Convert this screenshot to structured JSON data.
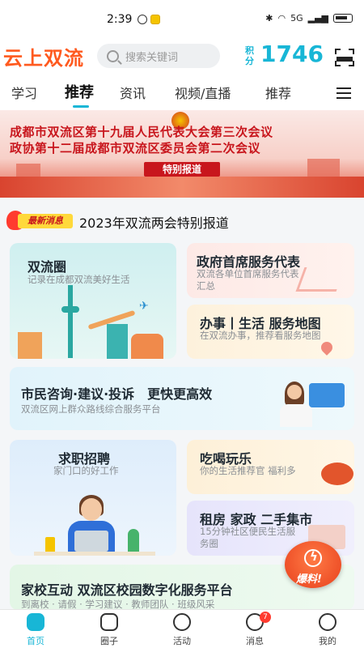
{
  "status_bar": {
    "time": "2:39",
    "signal_text": "5G"
  },
  "header": {
    "logo": "云上双流",
    "search_placeholder": "搜索关键词",
    "points_label": "积分",
    "points_value": "1746"
  },
  "tabs": [
    {
      "label": "学习"
    },
    {
      "label": "推荐",
      "active": true
    },
    {
      "label": "资讯"
    },
    {
      "label": "视频/直播"
    },
    {
      "label": "推荐"
    }
  ],
  "banner": {
    "line1": "成都市双流区第十九届人民代表大会第三次会议",
    "line2": "政协第十二届成都市双流区委员会第二次会议",
    "tag": "特别报道"
  },
  "news": {
    "badge": "最新消息",
    "title": "2023年双流两会特别报道"
  },
  "cards": {
    "circle": {
      "title": "双流圈",
      "sub": "记录在成都双流美好生活"
    },
    "rep": {
      "title": "政府首席服务代表",
      "sub": "双流各单位首席服务代表汇总"
    },
    "map": {
      "title": "办事丨生活 服务地图",
      "sub": "在双流办事，推荐看服务地图"
    },
    "consult": {
      "title": "市民咨询·建议·投诉　更快更高效",
      "sub": "双流区网上群众路线综合服务平台"
    },
    "job": {
      "title": "求职招聘",
      "sub": "家门口的好工作"
    },
    "food": {
      "title": "吃喝玩乐",
      "sub": "你的生活推荐官 福利多"
    },
    "rent": {
      "title": "租房 家政 二手集市",
      "sub": "15分钟社区便民生活服务圈"
    },
    "school": {
      "title": "家校互动 双流区校园数字化服务平台",
      "sub": "到离校 · 请假 · 学习建议 · 教师团队 · 班级风采"
    }
  },
  "float_button": {
    "label": "爆料!"
  },
  "bottom_nav": [
    {
      "label": "首页",
      "active": true
    },
    {
      "label": "圈子"
    },
    {
      "label": "活动"
    },
    {
      "label": "消息",
      "badge": "7"
    },
    {
      "label": "我的"
    }
  ],
  "colors": {
    "brand_orange": "#ff5a1f",
    "accent_cyan": "#18b6d6",
    "banner_red": "#c8161d"
  }
}
